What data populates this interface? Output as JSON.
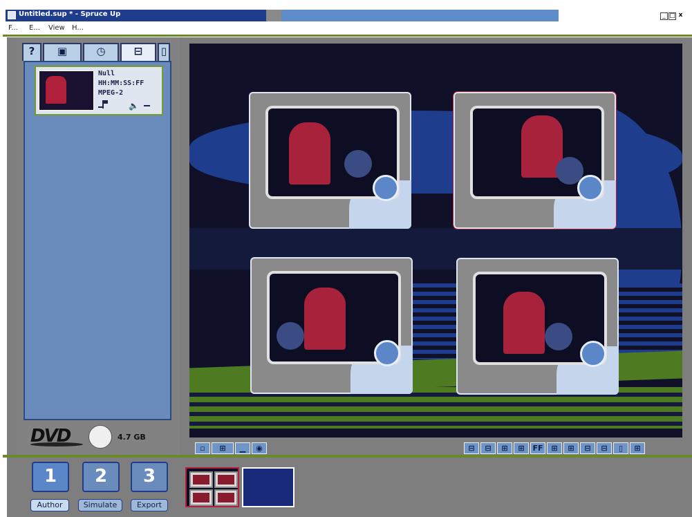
{
  "window": {
    "title": "Untitled.sup * - Spruce Up",
    "minimize_glyph": "_",
    "maximize_glyph": "□",
    "close_glyph": "x"
  },
  "menu": [
    "F...",
    "E...",
    "View",
    "H..."
  ],
  "tabs": [
    {
      "name": "help",
      "glyph": "?"
    },
    {
      "name": "media",
      "glyph": "▣"
    },
    {
      "name": "timer",
      "glyph": "◷"
    },
    {
      "name": "clips",
      "glyph": "⊟"
    },
    {
      "name": "doc",
      "glyph": "▯"
    }
  ],
  "clip": {
    "name": "Null",
    "duration": "HH:MM:SS:FF",
    "format": "MPEG-2"
  },
  "disc": {
    "logo": "DVD",
    "capacity": "4.7 GB"
  },
  "preview_toolbar_left": [
    "▫",
    "⊞",
    "▁",
    "◉"
  ],
  "preview_toolbar_right": [
    "⊟",
    "⊟",
    "⊞",
    "⊞",
    "FF",
    "⊞",
    "⊞",
    "⊟",
    "⊟",
    "▯",
    "⊞"
  ],
  "modes": [
    {
      "number": "1",
      "label": "Author"
    },
    {
      "number": "2",
      "label": "Simulate"
    },
    {
      "number": "3",
      "label": "Export"
    }
  ],
  "colors": {
    "title_bar": "#1e3d8c",
    "panel": "#6a8cbc",
    "accent_green": "#6a8a2a",
    "selection_red": "#b0203a"
  }
}
